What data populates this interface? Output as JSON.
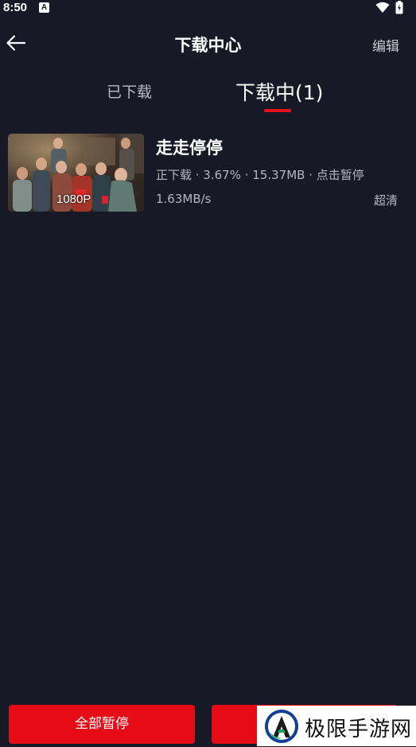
{
  "status_bar": {
    "time": "8:50",
    "notification_icon_letter": "A"
  },
  "header": {
    "title": "下载中心",
    "edit_label": "编辑"
  },
  "tabs": [
    {
      "label": "已下载",
      "active": false
    },
    {
      "label": "下载中(1)",
      "active": true
    }
  ],
  "downloads": [
    {
      "title": "走走停停",
      "resolution": "1080P",
      "status_line": "正下载 · 3.67% · 15.37MB · 点击暂停",
      "speed": "1.63MB/s",
      "quality": "超清"
    }
  ],
  "bottom": {
    "pause_all_label": "全部暂停"
  },
  "watermark": {
    "text": "极限手游网"
  },
  "colors": {
    "background": "#171a26",
    "accent_red": "#e50c18",
    "tab_indicator": "#e8121f",
    "secondary_text": "#b3b6c0"
  }
}
